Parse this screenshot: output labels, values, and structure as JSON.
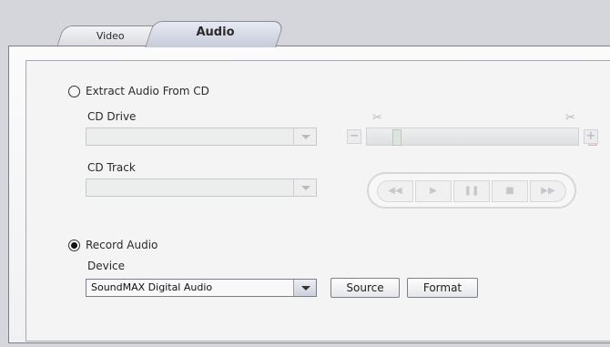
{
  "tabs": [
    {
      "label": "Video",
      "active": false
    },
    {
      "label": "Audio",
      "active": true
    }
  ],
  "extract": {
    "radio_label": "Extract Audio From CD",
    "selected": false,
    "cd_drive_label": "CD Drive",
    "cd_drive_value": "",
    "cd_track_label": "CD Track",
    "cd_track_value": ""
  },
  "slider": {
    "minus_label": "−",
    "plus_label": "+",
    "scissor_icon": "✂"
  },
  "transport": {
    "rewind": "◀◀",
    "play": "▶",
    "pause": "❚❚",
    "stop": "■",
    "forward": "▶▶"
  },
  "record": {
    "radio_label": "Record Audio",
    "selected": true,
    "device_label": "Device",
    "device_value": "SoundMAX Digital Audio",
    "source_button": "Source",
    "format_button": "Format"
  },
  "colors": {
    "background": "#d4d6dc",
    "panel": "#f4f4f5",
    "active_tab": "#c7cbda"
  }
}
